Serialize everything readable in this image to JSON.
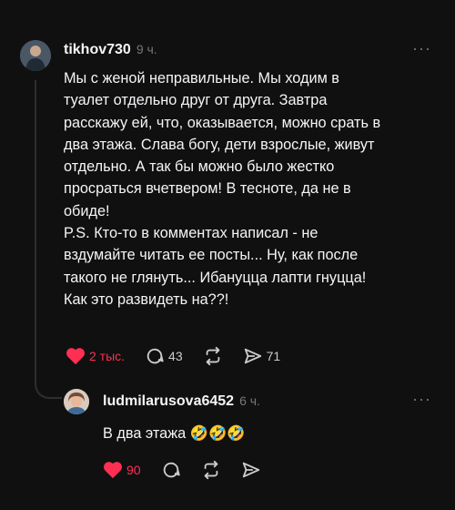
{
  "post": {
    "username": "tikhov730",
    "time": "9 ч.",
    "more": "···",
    "lines": [
      "Мы с женой неправильные. Мы ходим в",
      "туалет отдельно друг от друга. Завтра",
      "расскажу ей, что, оказывается, можно срать в",
      "два этажа. Слава богу, дети взрослые, живут",
      "отдельно. А так бы можно было жестко",
      "просраться вчетвером! В тесноте, да не в",
      "обиде!",
      "P.S. Кто-то в комментах написал - не",
      "вздумайте читать ее посты... Ну, как после",
      "такого не глянуть... Ибануцца лапти гнуцца!",
      "Как это развидеть на??!"
    ],
    "likes": "2 тыс.",
    "comments": "43",
    "shares": "71"
  },
  "reply": {
    "username": "ludmilarusova6452",
    "time": "6 ч.",
    "more": "···",
    "text": "В два этажа",
    "emoji": "🤣🤣🤣",
    "likes": "90"
  },
  "colors": {
    "like": "#ff2f54",
    "background": "#101010"
  }
}
